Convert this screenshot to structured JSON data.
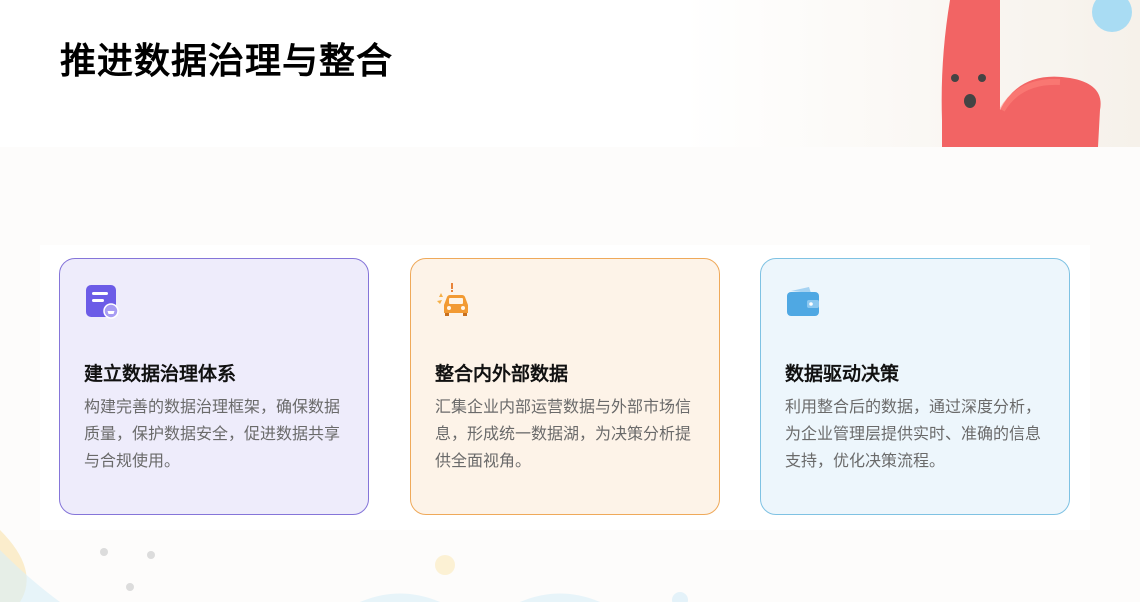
{
  "page": {
    "title": "推进数据治理与整合"
  },
  "cards": [
    {
      "title": "建立数据治理体系",
      "description": "构建完善的数据治理框架，确保数据质量，保护数据安全，促进数据共享与合规使用。",
      "icon": "document-icon",
      "accent": "#7b6cf0"
    },
    {
      "title": "整合内外部数据",
      "description": "汇集企业内部运营数据与外部市场信息，形成统一数据湖，为决策分析提供全面视角。",
      "icon": "car-alert-icon",
      "accent": "#f5a03a"
    },
    {
      "title": "数据驱动决策",
      "description": "利用整合后的数据，通过深度分析，为企业管理层提供实时、准确的信息支持，优化决策流程。",
      "icon": "wallet-icon",
      "accent": "#5aaee6"
    }
  ]
}
